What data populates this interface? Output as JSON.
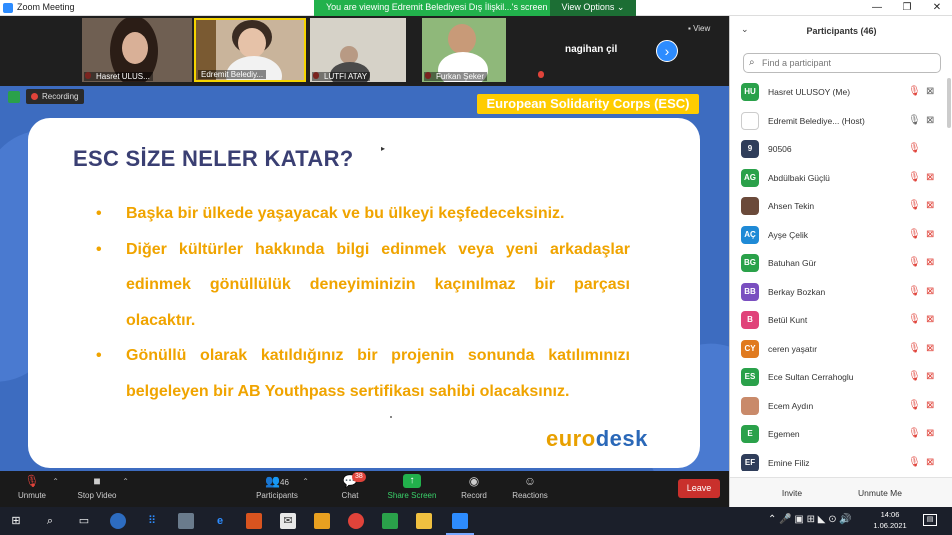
{
  "window": {
    "title": "Zoom Meeting",
    "share_banner": "You are viewing Edremit Belediyesi Dış İlişkil...'s screen",
    "view_options": "View Options ⌄",
    "minimize": "—",
    "maximize": "❐",
    "close": "✕"
  },
  "video_strip": {
    "tiles": [
      {
        "name": "Hasret ULUS..."
      },
      {
        "name": "Edremit Belediy..."
      },
      {
        "name": "LUTFI ATAY"
      },
      {
        "name": "Furkan Şeker"
      }
    ],
    "name_only": "nagihan çil",
    "next": "›",
    "view": "View"
  },
  "shared_screen": {
    "recording": "Recording",
    "badge": "European Solidarity Corps (ESC)",
    "heading": "ESC  SİZE NELER KATAR?",
    "bullets": [
      "Başka bir ülkede yaşayacak ve bu ülkeyi keşfedeceksiniz.",
      "Diğer kültürler hakkında bilgi edinmek veya yeni arkadaşlar edinmek gönüllülük deneyiminizin kaçınılmaz bir parçası olacaktır.",
      "Gönüllü olarak katıldığınız bir projenin sonunda katılımınızı belgeleyen bir AB Youthpass sertifikası sahibi olacaksınız."
    ],
    "logo_a": "euro",
    "logo_b": "desk"
  },
  "controls": {
    "unmute": "Unmute",
    "stop_video": "Stop Video",
    "participants": "Participants",
    "participants_count": "46",
    "chat": "Chat",
    "chat_badge": "38",
    "share_screen": "Share Screen",
    "record": "Record",
    "reactions": "Reactions",
    "leave": "Leave"
  },
  "panel": {
    "title": "Participants (46)",
    "search_placeholder": "Find a participant",
    "participants": [
      {
        "initials": "HU",
        "name": "Hasret ULUSOY (Me)",
        "color": "#2aa14a"
      },
      {
        "initials": "",
        "name": "Edremit Belediye... (Host)",
        "color": "#ffffff"
      },
      {
        "initials": "9",
        "name": "90506",
        "color": "#2f3d5a"
      },
      {
        "initials": "AG",
        "name": "Abdülbaki Güçlü",
        "color": "#2aa14a"
      },
      {
        "initials": "",
        "name": "Ahsen Tekin",
        "color": "#6b4a3a"
      },
      {
        "initials": "AÇ",
        "name": "Ayşe Çelik",
        "color": "#1f8ad6"
      },
      {
        "initials": "BG",
        "name": "Batuhan Gür",
        "color": "#2aa14a"
      },
      {
        "initials": "BB",
        "name": "Berkay Bozkan",
        "color": "#7a4fc0"
      },
      {
        "initials": "B",
        "name": "Betül Kunt",
        "color": "#e0437a"
      },
      {
        "initials": "CY",
        "name": "ceren yaşatır",
        "color": "#e07a1f"
      },
      {
        "initials": "ES",
        "name": "Ece Sultan  Cerrahoglu",
        "color": "#2aa14a"
      },
      {
        "initials": "",
        "name": "Ecem Aydın",
        "color": "#c98a6a"
      },
      {
        "initials": "E",
        "name": "Egemen",
        "color": "#2aa14a"
      },
      {
        "initials": "EF",
        "name": "Emine Filiz",
        "color": "#2f3d5a"
      }
    ],
    "invite": "Invite",
    "unmute_me": "Unmute Me"
  },
  "taskbar": {
    "time": "14:06",
    "date": "1.06.2021",
    "start": "⊞",
    "search": "⌕",
    "taskview": "▭",
    "tray": "⌃  🎤  ▣  ⊞  ◣  ⊙  🔊",
    "notifications": "▤"
  }
}
